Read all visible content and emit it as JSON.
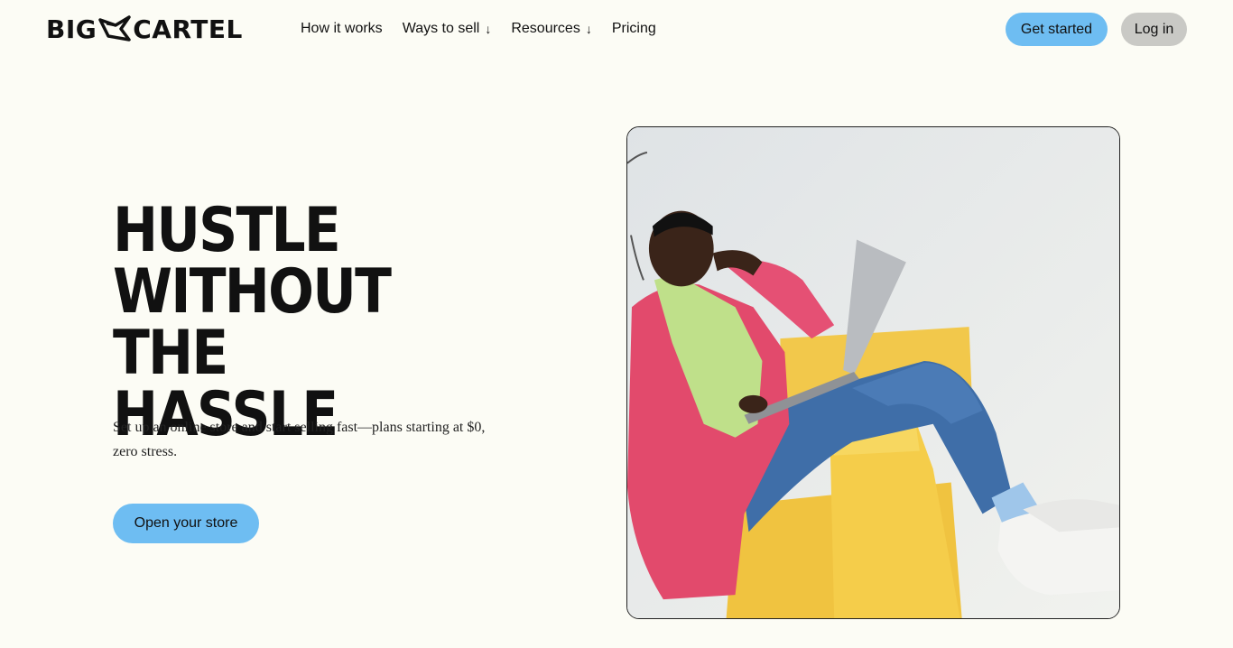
{
  "brand": {
    "logo_left": "BIG",
    "logo_right": "CARTEL"
  },
  "nav": {
    "items": [
      {
        "label": "How it works",
        "has_dropdown": false
      },
      {
        "label": "Ways to sell",
        "has_dropdown": true
      },
      {
        "label": "Resources",
        "has_dropdown": true
      },
      {
        "label": "Pricing",
        "has_dropdown": false
      }
    ],
    "dropdown_arrow": "↓"
  },
  "header": {
    "get_started_label": "Get started",
    "login_label": "Log in"
  },
  "hero": {
    "title_lines": [
      "HUSTLE",
      "WITHOUT THE",
      "HASSLE"
    ],
    "subtitle": "Set up an online store and start selling fast—plans starting at $0, zero stress.",
    "cta_label": "Open your store"
  },
  "image": {
    "icon": "woman-with-laptop-photo"
  },
  "colors": {
    "background": "#fcfcf5",
    "accent_blue": "#6ebdf2",
    "login_gray": "#c9c9c5",
    "text": "#111111"
  }
}
